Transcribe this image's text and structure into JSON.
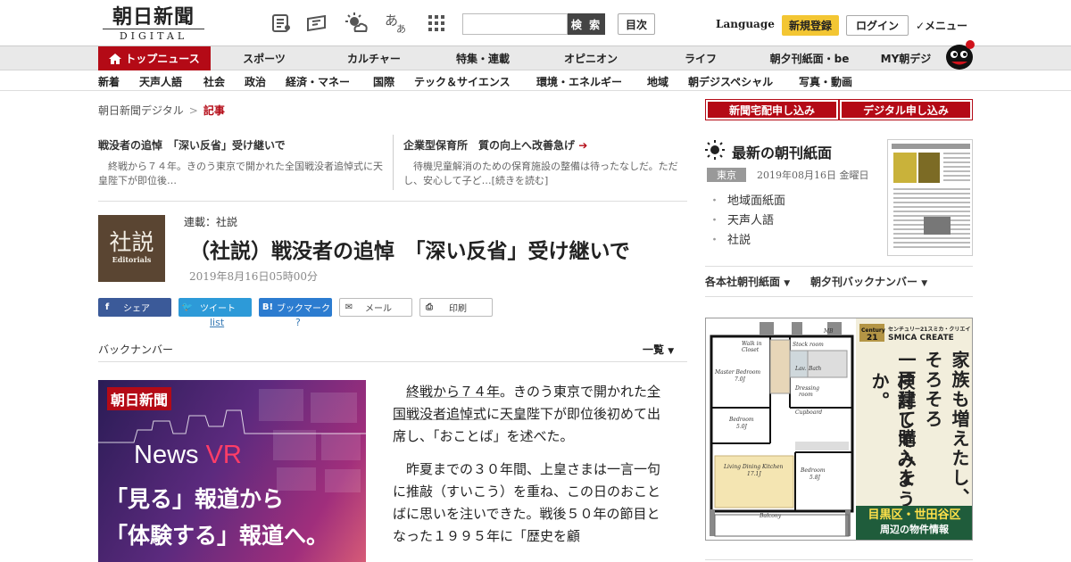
{
  "header": {
    "logo_main": "朝日新聞",
    "logo_sub": "DIGITAL",
    "search_label": "検 索",
    "toc_label": "目次",
    "language": "Language",
    "signup": "新規登録",
    "login": "ログイン",
    "menu": "✓メニュー"
  },
  "nav_primary": [
    {
      "label": "トップニュース"
    },
    {
      "label": "スポーツ"
    },
    {
      "label": "カルチャー"
    },
    {
      "label": "特集・連載"
    },
    {
      "label": "オピニオン"
    },
    {
      "label": "ライフ"
    },
    {
      "label": "朝夕刊紙面・be"
    },
    {
      "label": "MY朝デジ"
    }
  ],
  "nav_secondary": [
    "新着",
    "天声人語",
    "社会",
    "政治",
    "経済・マネー",
    "国際",
    "テック＆サイエンス",
    "環境・エネルギー",
    "地域",
    "朝デジスペシャル",
    "写真・動画"
  ],
  "breadcrumb": {
    "home": "朝日新聞デジタル",
    "sep": ">",
    "current": "記事"
  },
  "related": [
    {
      "title": "戦没者の追悼　「深い反省」受け継いで",
      "body": "終戦から７４年。きのう東京で開かれた全国戦没者追悼式に天皇陛下が即位後…"
    },
    {
      "title": "企業型保育所　質の向上へ改善急げ",
      "body": "待機児童解消のための保育施設の整備は待ったなしだ。ただし、安心して子ど…[続きを読む]"
    }
  ],
  "article": {
    "image_kanji": "社説",
    "image_en": "Editorials",
    "series": "連載：社説",
    "headline": "（社説）戦没者の追悼　「深い反省」受け継いで",
    "date": "2019年8月16日05時00分"
  },
  "share": {
    "facebook": "シェア",
    "twitter": "ツイート",
    "twitter_sub": "list",
    "hatena": "ブックマーク",
    "hatena_sub": "?",
    "mail": "メール",
    "print": "印刷"
  },
  "backnumber": {
    "label": "バックナンバー",
    "all": "一覧"
  },
  "vr_ad": {
    "brand": "朝日新聞",
    "news": "News",
    "vr": "VR",
    "line1": "「見る」報道から",
    "line2": "「体験する」報道へ。"
  },
  "body": {
    "p1_a": "終戦から７４年",
    "p1_b": "。きのう東京で開かれた",
    "p1_c": "全国戦没者追悼式",
    "p1_d": "に",
    "p1_e": "天皇",
    "p1_f": "陛下が即位後初めて出席し、「おことば」を述べた。",
    "p2": "昨夏までの３０年間、上皇さまは一言一句に推敲（すいこう）を重ね、この日のおことばに思いを注いできた。戦後５０年の節目となった１９９５年に「歴史を顧"
  },
  "right": {
    "btn_delivery": "新聞宅配申し込み",
    "btn_digital": "デジタル申し込み",
    "morning_title": "最新の朝刊紙面",
    "region": "東京",
    "paper_date": "2019年08月16日 金曜日",
    "links": [
      "地域面紙面",
      "天声人語",
      "社説"
    ],
    "drop1": "各本社朝刊紙面",
    "drop2": "朝夕刊バックナンバー"
  },
  "house_ad": {
    "logo": "Century21 センチュリー21スミカ・クリエイト SMICA CREATE",
    "col1": "家族も増えたし、",
    "col2": "そろそろ",
    "col3": "一戸建て購入を",
    "col4": "検討してみようか。",
    "area": "目黒区・世田谷区",
    "area_sub": "周辺の物件情報",
    "rooms": [
      "Walk in Closet",
      "Stock room",
      "Master Bedroom",
      "7.0J",
      "Bath",
      "Dressing room",
      "Bedroom",
      "5.0J",
      "Living Dining Kitchen",
      "17.1J",
      "Bedroom",
      "5.8J",
      "Balcony",
      "Cupboard",
      "Lav.",
      "MB"
    ]
  },
  "colors": {
    "brand_red": "#b40a16",
    "signup_yellow": "#f3c633"
  }
}
